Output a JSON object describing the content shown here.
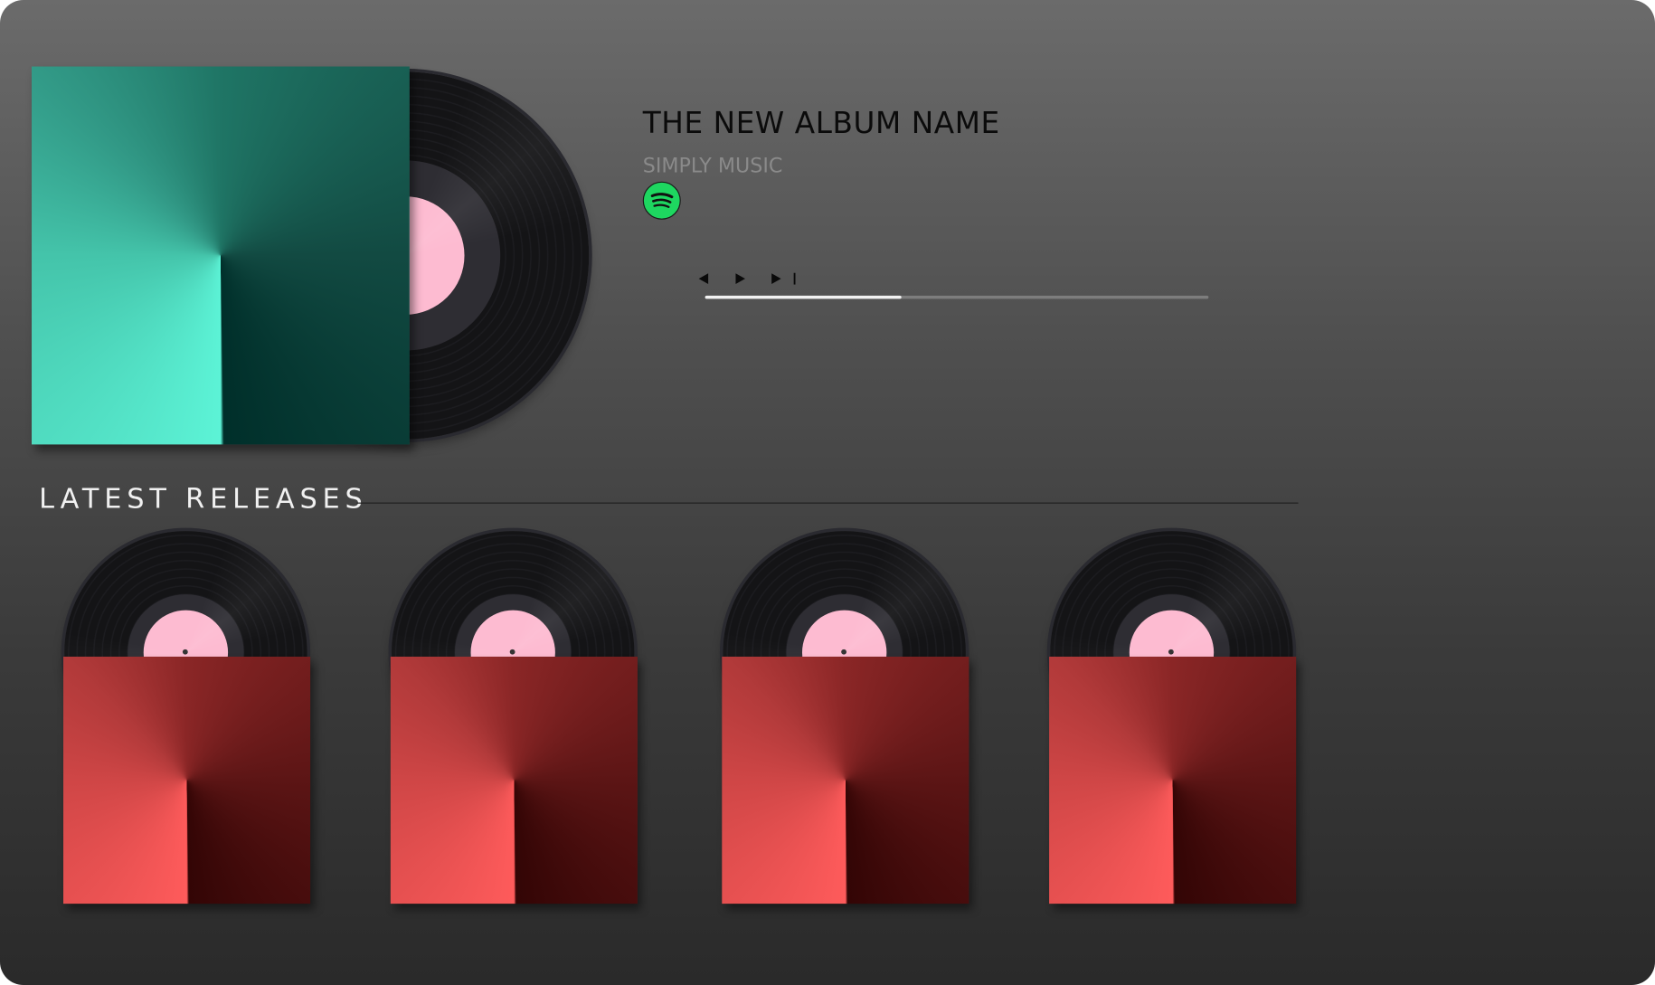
{
  "featured_album": {
    "title": "THE NEW ALBUM NAME",
    "artist": "SIMPLY MUSIC",
    "cover_colors": [
      "#5cf3d6",
      "#002f2a"
    ],
    "record_label_color": "#fdbbd1",
    "streaming_service_icon": "spotify-icon"
  },
  "player": {
    "controls": [
      "previous-icon",
      "play-icon",
      "next-icon"
    ],
    "progress_fraction": 0.39
  },
  "latest_releases": {
    "heading": "LATEST RELEASES",
    "items": [
      {
        "cover_colors": [
          "#fe5b5b",
          "#330505"
        ],
        "record_label_color": "#fdbbd1"
      },
      {
        "cover_colors": [
          "#fe5b5b",
          "#330505"
        ],
        "record_label_color": "#fdbbd1"
      },
      {
        "cover_colors": [
          "#fe5b5b",
          "#330505"
        ],
        "record_label_color": "#fdbbd1"
      },
      {
        "cover_colors": [
          "#fe5b5b",
          "#330505"
        ],
        "record_label_color": "#fdbbd1"
      }
    ]
  }
}
